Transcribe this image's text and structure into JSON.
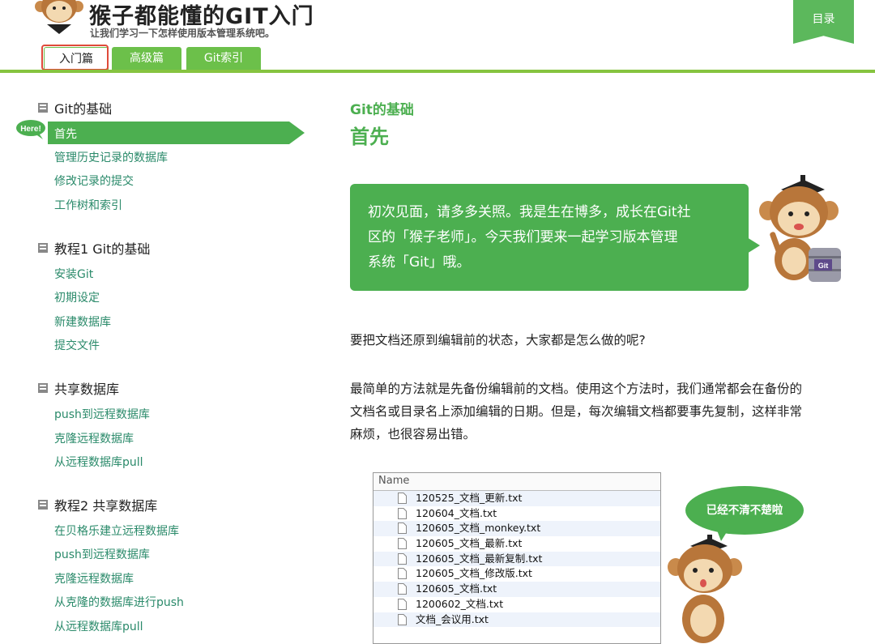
{
  "header": {
    "site_title": "猴子都能懂的GIT入门",
    "site_subtitle": "让我们学习一下怎样使用版本管理系统吧。",
    "toc_label": "目录",
    "tabs": [
      {
        "label": "入门篇",
        "active": true
      },
      {
        "label": "高级篇",
        "active": false
      },
      {
        "label": "Git索引",
        "active": false
      }
    ]
  },
  "sidebar": {
    "here_badge": "Here!",
    "sections": [
      {
        "title": "Git的基础",
        "items": [
          "首先",
          "管理历史记录的数据库",
          "修改记录的提交",
          "工作树和索引"
        ],
        "active_index": 0
      },
      {
        "title": "教程1 Git的基础",
        "items": [
          "安装Git",
          "初期设定",
          "新建数据库",
          "提交文件"
        ]
      },
      {
        "title": "共享数据库",
        "items": [
          "push到远程数据库",
          "克隆远程数据库",
          "从远程数据库pull"
        ]
      },
      {
        "title": "教程2 共享数据库",
        "items": [
          "在贝格乐建立远程数据库",
          "push到远程数据库",
          "克隆远程数据库",
          "从克隆的数据库进行push",
          "从远程数据库pull"
        ]
      }
    ]
  },
  "main": {
    "breadcrumb": "Git的基础",
    "title": "首先",
    "intro_lines": [
      "初次见面，请多多关照。我是生在博多，成长在Git社",
      "区的「猴子老师」。今天我们要来一起学习版本管理",
      "系统「Git」哦。"
    ],
    "paragraph1": "要把文档还原到编辑前的状态，大家都是怎么做的呢?",
    "paragraph2_lines": [
      "最简单的方法就是先备份编辑前的文档。使用这个方法时，我们通常都会在备份的",
      "文档名或目录名上添加编辑的日期。但是，每次编辑文档都要事先复制，这样非常",
      "麻烦，也很容易出错。"
    ],
    "file_list": {
      "header": "Name",
      "files": [
        "120525_文档_更新.txt",
        "120604_文档.txt",
        "120605_文档_monkey.txt",
        "120605_文档_最新.txt",
        "120605_文档_最新复制.txt",
        "120605_文档_修改版.txt",
        "120605_文档.txt",
        "1200602_文档.txt",
        "文档_会议用.txt"
      ]
    },
    "speech_bubble": "已经不清不楚啦",
    "git_box_label": "Git"
  },
  "colors": {
    "brand_green": "#4caf50",
    "tab_green": "#6cc04a",
    "link_teal": "#2a8a6a",
    "highlight_red": "#e04a3a"
  }
}
